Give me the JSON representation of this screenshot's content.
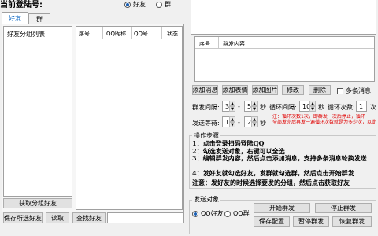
{
  "header": {
    "title_cut": "当前登陆号:",
    "radio_friend": "好友",
    "radio_group": "群"
  },
  "left": {
    "tab_friend": "好友",
    "tab_group": "群",
    "group_list_title": "好友分组列表",
    "table_headers": [
      "序号",
      "QQ昵称",
      "QQ号",
      "状态"
    ],
    "get_groups_btn": "获取分组好友",
    "save_selected_btn": "保存所选好友",
    "read_btn": "读取",
    "find_friend_btn": "查找好友"
  },
  "right": {
    "msg_table_headers": [
      "序号",
      "群发内容"
    ],
    "add_message_btn": "添加消息",
    "add_emoji_btn": "添加表情",
    "add_image_btn": "添加图片",
    "edit_btn": "修改",
    "delete_btn": "删除",
    "multi_msg_label": "多条消息",
    "send_interval_label": "群发间隔:",
    "interval_from": "3",
    "interval_to": "5",
    "sec1": "秒",
    "sep1": "-",
    "loop_interval_label": "循环间隔:",
    "loop_interval_value": "10",
    "sec2": "秒",
    "loop_count_label": "循环次数:",
    "loop_count_value": "1",
    "times_label": "次",
    "send_wait_label": "发送等待:",
    "wait_from": "1",
    "wait_to": "2",
    "sec3": "秒",
    "sep2": "-",
    "red_note_1": "注：循环次数1次，即群发一次后停止，循环",
    "red_note_2": "全部发完后再发一遍循环次数就是为多少次，以此类推。",
    "steps_title": "操作步骤",
    "steps": [
      "1：点击登录扫码登陆QQ",
      "2：勾选发送对象，右键可以全选",
      "3：编辑群发内容，然后点击添加消息，支持多条消息轮换发送",
      "4：发好友就勾选好友，发群就勾选群，然后点击开始群发"
    ],
    "note": "注意：发好友的时候选择要发的分组，然后点击获取好友",
    "target_title": "发送对象",
    "target_friend": "QQ好友",
    "target_group": "QQ群",
    "start_btn": "开始群发",
    "stop_btn": "停止群发",
    "save_config_btn": "保存配置",
    "pause_btn": "暂停群发",
    "resume_btn": "恢复群发"
  },
  "colors": {
    "accent": "#1a5fb4",
    "note_red": "#e00000",
    "tab_blue": "#0060c0"
  }
}
